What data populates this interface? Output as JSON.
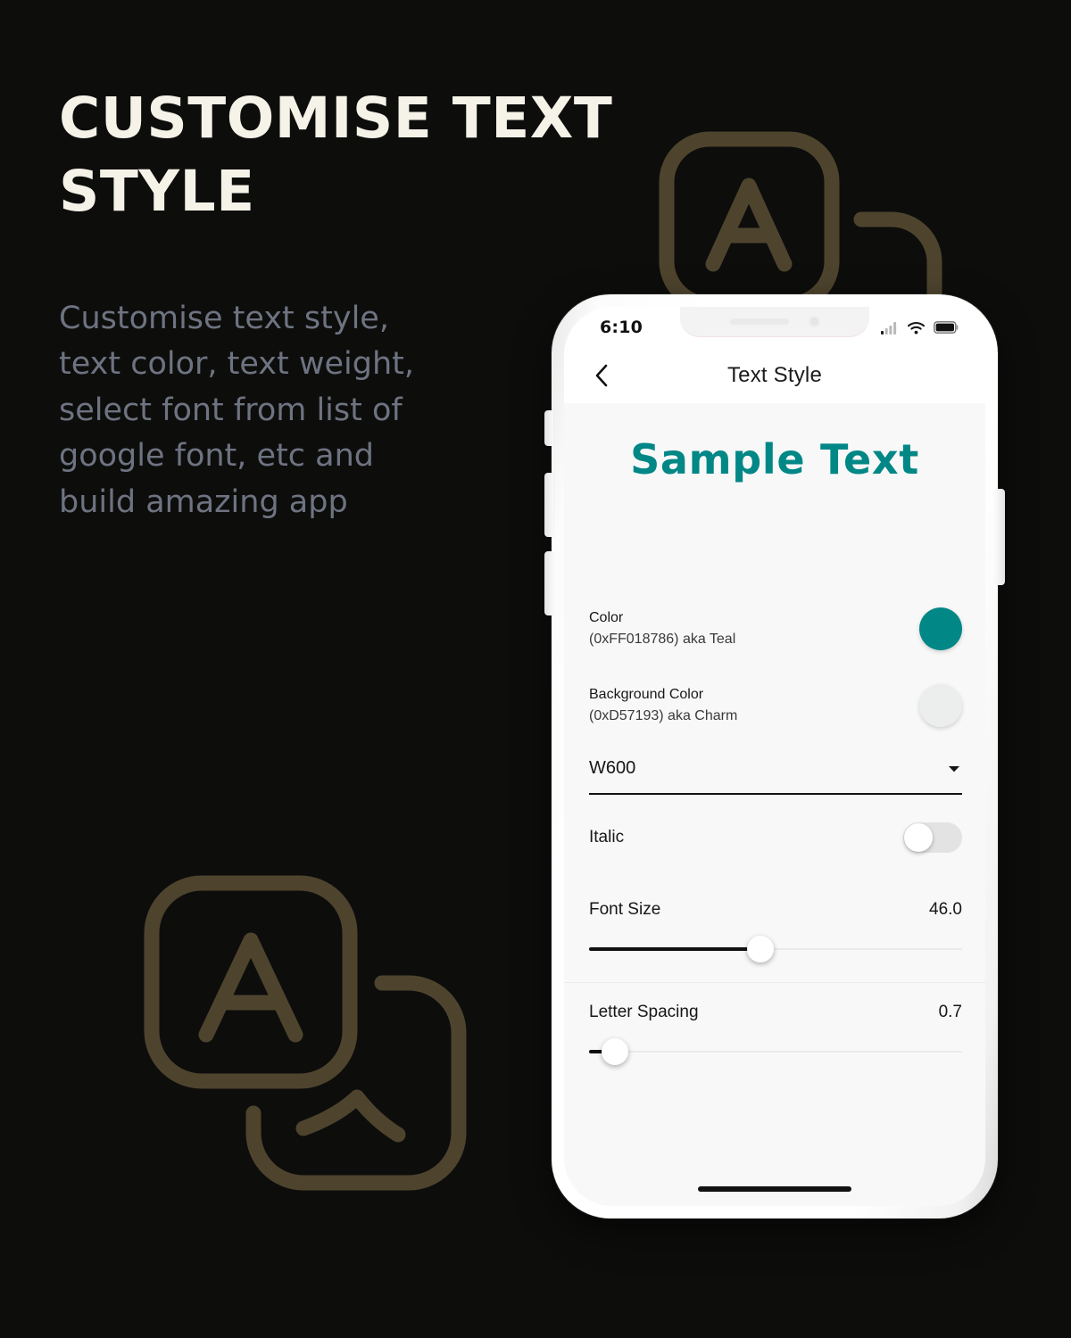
{
  "promo": {
    "title": "CUSTOMISE TEXT\nSTYLE",
    "subtitle": "Customise text style,\ntext color, text weight,\nselect font from list of\ngoogle font, etc and\nbuild amazing app",
    "title_color": "#f5f2e8",
    "subtitle_color": "#6e7381",
    "background_color": "#0d0d0c",
    "decoration_color": "#4e442e"
  },
  "phone": {
    "status_bar": {
      "time": "6:10",
      "signal_icon": "cellular-signal-icon",
      "wifi_icon": "wifi-icon",
      "battery_icon": "battery-full-icon"
    },
    "app_bar": {
      "back_icon": "chevron-left-icon",
      "title": "Text Style"
    },
    "preview": {
      "sample_text": "Sample Text",
      "color": "#018786",
      "font_size": 46,
      "letter_spacing": 0.7,
      "weight": "W600",
      "italic": false
    },
    "settings": [
      {
        "label": "Color",
        "sub": "(0xFF018786) aka Teal",
        "swatch_color": "#018786"
      },
      {
        "label": "Background Color",
        "sub": "(0xD57193) aka Charm",
        "swatch_color": "#eceeed"
      }
    ],
    "weight_dropdown": {
      "value": "W600",
      "arrow_icon": "chevron-down-icon"
    },
    "italic_row": {
      "label": "Italic",
      "enabled": false
    },
    "font_size_slider": {
      "label": "Font Size",
      "value": "46.0",
      "percent": 46
    },
    "letter_spacing_slider": {
      "label": "Letter Spacing",
      "value": "0.7",
      "percent": 7
    },
    "home_indicator": "home-indicator"
  }
}
